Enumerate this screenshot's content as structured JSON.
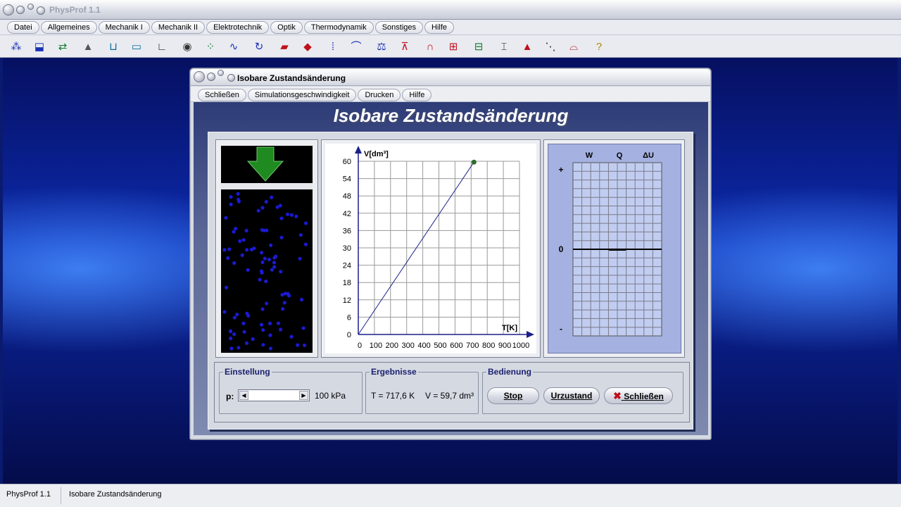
{
  "app": {
    "title": "PhysProf 1.1"
  },
  "menubar": [
    "Datei",
    "Allgemeines",
    "Mechanik I",
    "Mechanik II",
    "Elektrotechnik",
    "Optik",
    "Thermodynamik",
    "Sonstiges",
    "Hilfe"
  ],
  "toolbar": [
    {
      "icon": "atoms-icon",
      "glyph": "⁂",
      "color": "#1a2fb3"
    },
    {
      "icon": "spring-cart-icon",
      "glyph": "⬓",
      "color": "#1a2fb3"
    },
    {
      "icon": "exchange-icon",
      "glyph": "⇄",
      "color": "#0b7a2a"
    },
    {
      "icon": "slope-icon",
      "glyph": "▲",
      "color": "#555555"
    },
    {
      "icon": "scale-icon",
      "glyph": "⊔",
      "color": "#0a6a9a"
    },
    {
      "icon": "pipe-icon",
      "glyph": "▭",
      "color": "#0a6a9a"
    },
    {
      "icon": "axes-icon",
      "glyph": "∟",
      "color": "#222222"
    },
    {
      "icon": "eye-icon",
      "glyph": "◉",
      "color": "#333333"
    },
    {
      "icon": "dots-icon",
      "glyph": "⁘",
      "color": "#0b7a2a"
    },
    {
      "icon": "wave-icon",
      "glyph": "∿",
      "color": "#1a2fb3"
    },
    {
      "icon": "rotation-icon",
      "glyph": "↻",
      "color": "#1a2fb3"
    },
    {
      "icon": "magnet-icon",
      "glyph": "▰",
      "color": "#c0101a"
    },
    {
      "icon": "diamond-icon",
      "glyph": "◆",
      "color": "#c0101a"
    },
    {
      "icon": "resistor-icon",
      "glyph": "⁞",
      "color": "#1a2fb3"
    },
    {
      "icon": "curve-icon",
      "glyph": "⌒",
      "color": "#1a2fb3"
    },
    {
      "icon": "balance-icon",
      "glyph": "⚖",
      "color": "#1a2fb3"
    },
    {
      "icon": "transistor-icon",
      "glyph": "⊼",
      "color": "#c0101a"
    },
    {
      "icon": "horseshoe-magnet-icon",
      "glyph": "∩",
      "color": "#c0101a"
    },
    {
      "icon": "motor-icon",
      "glyph": "⊞",
      "color": "#c0101a"
    },
    {
      "icon": "coil-icon",
      "glyph": "⊟",
      "color": "#0b7a2a"
    },
    {
      "icon": "lens-icon",
      "glyph": "⌶",
      "color": "#222222"
    },
    {
      "icon": "prism-icon",
      "glyph": "▲",
      "color": "#c0101a"
    },
    {
      "icon": "decay-icon",
      "glyph": "⋱",
      "color": "#222222"
    },
    {
      "icon": "spectrum-icon",
      "glyph": "⌓",
      "color": "#c0101a"
    },
    {
      "icon": "help-icon",
      "glyph": "?",
      "color": "#b08a00"
    }
  ],
  "dialog": {
    "title": "Isobare Zustandsänderung",
    "menu": [
      "Schließen",
      "Simulationsgeschwindigkeit",
      "Drucken",
      "Hilfe"
    ],
    "heading": "Isobare Zustandsänderung"
  },
  "chart_data": {
    "type": "line",
    "xlabel": "T[K]",
    "ylabel": "V[dm³]",
    "xlim": [
      0,
      1000
    ],
    "ylim": [
      0,
      60
    ],
    "x_ticks": [
      0,
      100,
      200,
      300,
      400,
      500,
      600,
      700,
      800,
      900,
      1000
    ],
    "y_ticks": [
      0,
      6,
      12,
      18,
      24,
      30,
      36,
      42,
      48,
      54,
      60
    ],
    "series": [
      {
        "x": [
          0,
          717.6
        ],
        "y": [
          0,
          59.7
        ]
      }
    ],
    "marker": {
      "x": 717.6,
      "y": 59.7,
      "color": "#2d6b2d"
    },
    "grid": true,
    "line_color": "#1a1f8a"
  },
  "energy_chart": {
    "columns": [
      "W",
      "Q",
      "ΔU"
    ],
    "plus": "+",
    "zero": "0",
    "minus": "-"
  },
  "controls": {
    "einstellung_label": "Einstellung",
    "p_label": "p:",
    "p_value": "100 kPa",
    "ergebnisse_label": "Ergebnisse",
    "t_result": "T = 717,6 K",
    "v_result": "V = 59,7 dm³",
    "bedienung_label": "Bedienung",
    "stop": "Stop",
    "urzustand": "Urzustand",
    "schliessen": "Schließen"
  },
  "status": {
    "app": "PhysProf 1.1",
    "module": "Isobare Zustandsänderung"
  },
  "colors": {
    "piston_arrow": "#1f8a1f",
    "molecule": "#1a1ad0",
    "desktop": "#0c2bb0"
  }
}
